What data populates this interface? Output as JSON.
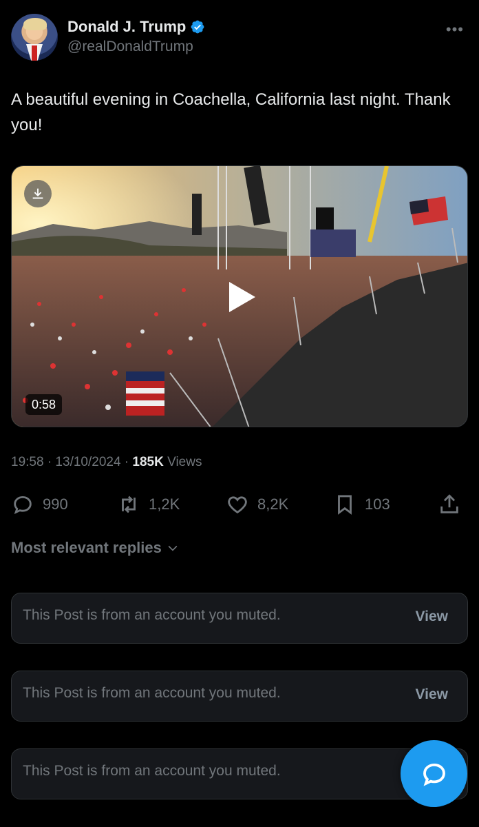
{
  "author": {
    "display_name": "Donald J. Trump",
    "handle": "@realDonaldTrump",
    "verified": true
  },
  "post": {
    "text": "A beautiful evening in Coachella, California last night. Thank you!",
    "video_duration": "0:58",
    "timestamp": "19:58 · 13/10/2024 · ",
    "views_count": "185K",
    "views_label": " Views"
  },
  "actions": {
    "replies": "990",
    "reposts": "1,2K",
    "likes": "8,2K",
    "bookmarks": "103"
  },
  "replies_section": {
    "title": "Most relevant replies",
    "muted": [
      {
        "text": "This Post is from an account you muted.",
        "action": "View"
      },
      {
        "text": "This Post is from an account you muted.",
        "action": "View"
      },
      {
        "text": "This Post is from an account you muted.",
        "action": ""
      }
    ]
  },
  "icons": {
    "more": "more-icon",
    "verified": "verified-icon",
    "download": "download-icon",
    "play": "play-icon",
    "reply": "reply-icon",
    "repost": "repost-icon",
    "like": "heart-icon",
    "bookmark": "bookmark-icon",
    "share": "share-icon",
    "chevron": "chevron-down-icon",
    "compose": "compose-message-icon"
  },
  "colors": {
    "accent": "#1d9bf0",
    "background": "#000000",
    "muted_text": "#71767b"
  }
}
